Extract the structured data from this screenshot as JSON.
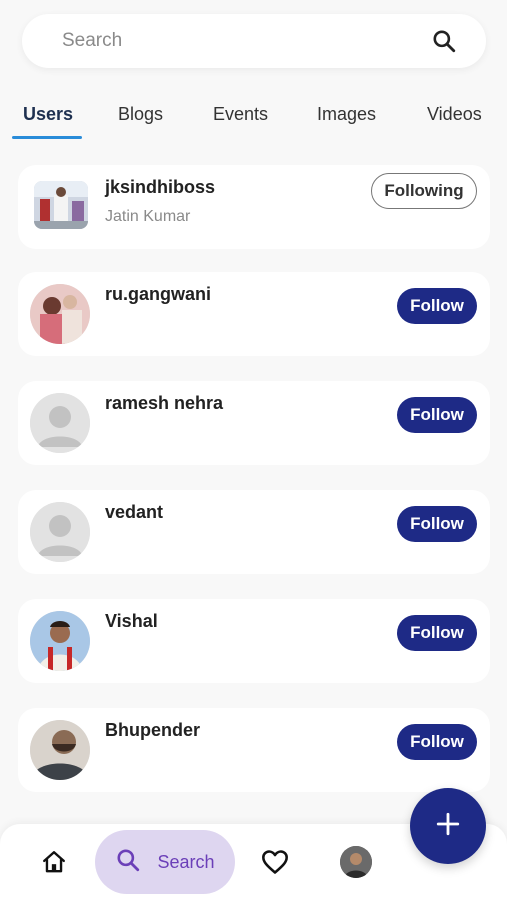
{
  "search": {
    "placeholder": "Search",
    "icon": "search-icon"
  },
  "tabs": [
    {
      "label": "Users",
      "active": true
    },
    {
      "label": "Blogs",
      "active": false
    },
    {
      "label": "Events",
      "active": false
    },
    {
      "label": "Images",
      "active": false
    },
    {
      "label": "Videos",
      "active": false
    }
  ],
  "users": [
    {
      "username": "jksindhiboss",
      "fullname": "Jatin Kumar",
      "action": "Following",
      "avatar": "photo"
    },
    {
      "username": "ru.gangwani",
      "fullname": "",
      "action": "Follow",
      "avatar": "photo"
    },
    {
      "username": "ramesh nehra",
      "fullname": "",
      "action": "Follow",
      "avatar": "default"
    },
    {
      "username": "vedant",
      "fullname": "",
      "action": "Follow",
      "avatar": "default"
    },
    {
      "username": "Vishal",
      "fullname": "",
      "action": "Follow",
      "avatar": "photo"
    },
    {
      "username": "Bhupender",
      "fullname": "",
      "action": "Follow",
      "avatar": "photo"
    }
  ],
  "bottom_nav": {
    "home_icon": "home-icon",
    "search_label": "Search",
    "favorites_icon": "heart-icon",
    "profile_icon": "avatar"
  },
  "fab": {
    "icon": "plus-icon"
  },
  "colors": {
    "accent": "#1e2a86",
    "tab_underline": "#2a8cd9",
    "search_pill": "#ded6f0",
    "search_pill_text": "#6b3fb8"
  }
}
